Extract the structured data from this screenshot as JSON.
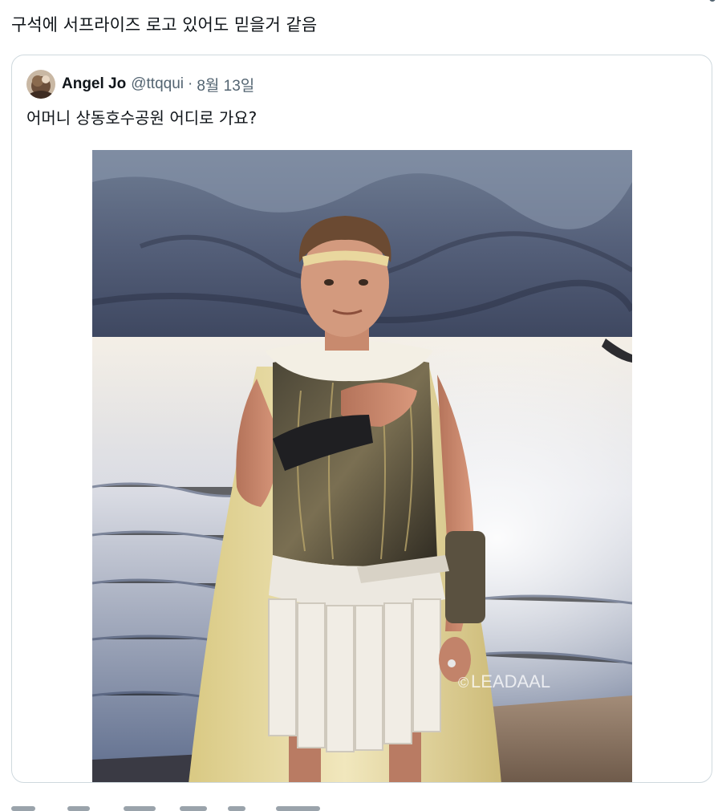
{
  "tweet": {
    "text": "구석에 서프라이즈 로고 있어도 믿을거 같음"
  },
  "quote": {
    "author": {
      "display_name": "Angel Jo",
      "handle": "@ttqqui",
      "separator": "·",
      "date": "8월 13일",
      "avatar_icon": "avatar-photo"
    },
    "text": "어머니 상동호수공원 어디로 가요?",
    "media": {
      "watermark": "LEADAAL",
      "watermark_symbol": "©"
    }
  },
  "colors": {
    "text_primary": "#0f1419",
    "text_secondary": "#536471",
    "border": "#cfd9de"
  }
}
